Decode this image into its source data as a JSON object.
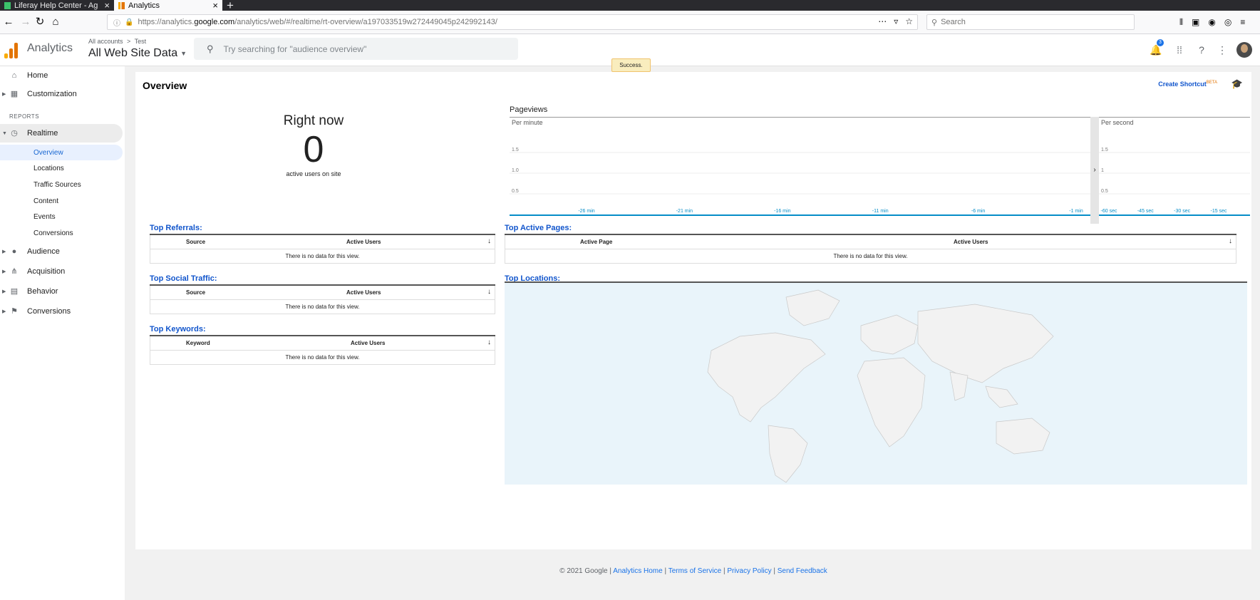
{
  "browser": {
    "tabs": [
      {
        "title": "Liferay Help Center - Ag",
        "active": false
      },
      {
        "title": "Analytics",
        "active": true
      }
    ],
    "url_prefix": "https://analytics.",
    "url_host": "google.com",
    "url_path": "/analytics/web/#/realtime/rt-overview/a197033519w272449045p242992143/",
    "search_placeholder": "Search"
  },
  "header": {
    "app_title": "Analytics",
    "breadcrumb_all_accounts": "All accounts",
    "breadcrumb_separator": ">",
    "breadcrumb_account": "Test",
    "view_name": "All Web Site Data",
    "search_placeholder": "Try searching for \"audience overview\"",
    "notification_count": "3",
    "logo_colors": [
      "#f9ab00",
      "#e37400",
      "#e37400"
    ]
  },
  "toast": {
    "text": "Success."
  },
  "sidebar": {
    "home": "Home",
    "customization": "Customization",
    "reports_label": "REPORTS",
    "realtime": "Realtime",
    "realtime_children": [
      "Overview",
      "Locations",
      "Traffic Sources",
      "Content",
      "Events",
      "Conversions"
    ],
    "audience": "Audience",
    "acquisition": "Acquisition",
    "behavior": "Behavior",
    "conversions": "Conversions"
  },
  "main": {
    "title": "Overview",
    "create_shortcut": "Create Shortcut",
    "create_shortcut_badge": "BETA",
    "right_now_title": "Right now",
    "right_now_count": "0",
    "right_now_sub": "active users on site",
    "pageviews_label": "Pageviews",
    "top_referrals": {
      "title": "Top Referrals:",
      "col1": "Source",
      "col2": "Active Users",
      "empty": "There is no data for this view."
    },
    "top_social": {
      "title": "Top Social Traffic:",
      "col1": "Source",
      "col2": "Active Users",
      "empty": "There is no data for this view."
    },
    "top_keywords": {
      "title": "Top Keywords:",
      "col1": "Keyword",
      "col2": "Active Users",
      "empty": "There is no data for this view."
    },
    "top_active_pages": {
      "title": "Top Active Pages:",
      "col1": "Active Page",
      "col2": "Active Users",
      "empty": "There is no data for this view."
    },
    "top_locations": {
      "title": "Top Locations:"
    }
  },
  "chart_data": [
    {
      "type": "bar",
      "title": "Per minute",
      "x": [
        "-26 min",
        "-21 min",
        "-16 min",
        "-11 min",
        "-6 min",
        "-1 min"
      ],
      "values": [
        0,
        0,
        0,
        0,
        0,
        0
      ],
      "yticks": [
        "1.5",
        "1.0",
        "0.5"
      ],
      "ylim": [
        0,
        2
      ],
      "accent": "#058dc7"
    },
    {
      "type": "bar",
      "title": "Per second",
      "x": [
        "-60 sec",
        "-45 sec",
        "-30 sec",
        "-15 sec"
      ],
      "values": [
        0,
        0,
        0,
        0
      ],
      "yticks": [
        "1.5",
        "1",
        "0.5"
      ],
      "ylim": [
        0,
        2
      ],
      "accent": "#058dc7"
    }
  ],
  "footer": {
    "copyright": "© 2021 Google |",
    "links": [
      "Analytics Home",
      "Terms of Service",
      "Privacy Policy",
      "Send Feedback"
    ],
    "separator": "|"
  }
}
